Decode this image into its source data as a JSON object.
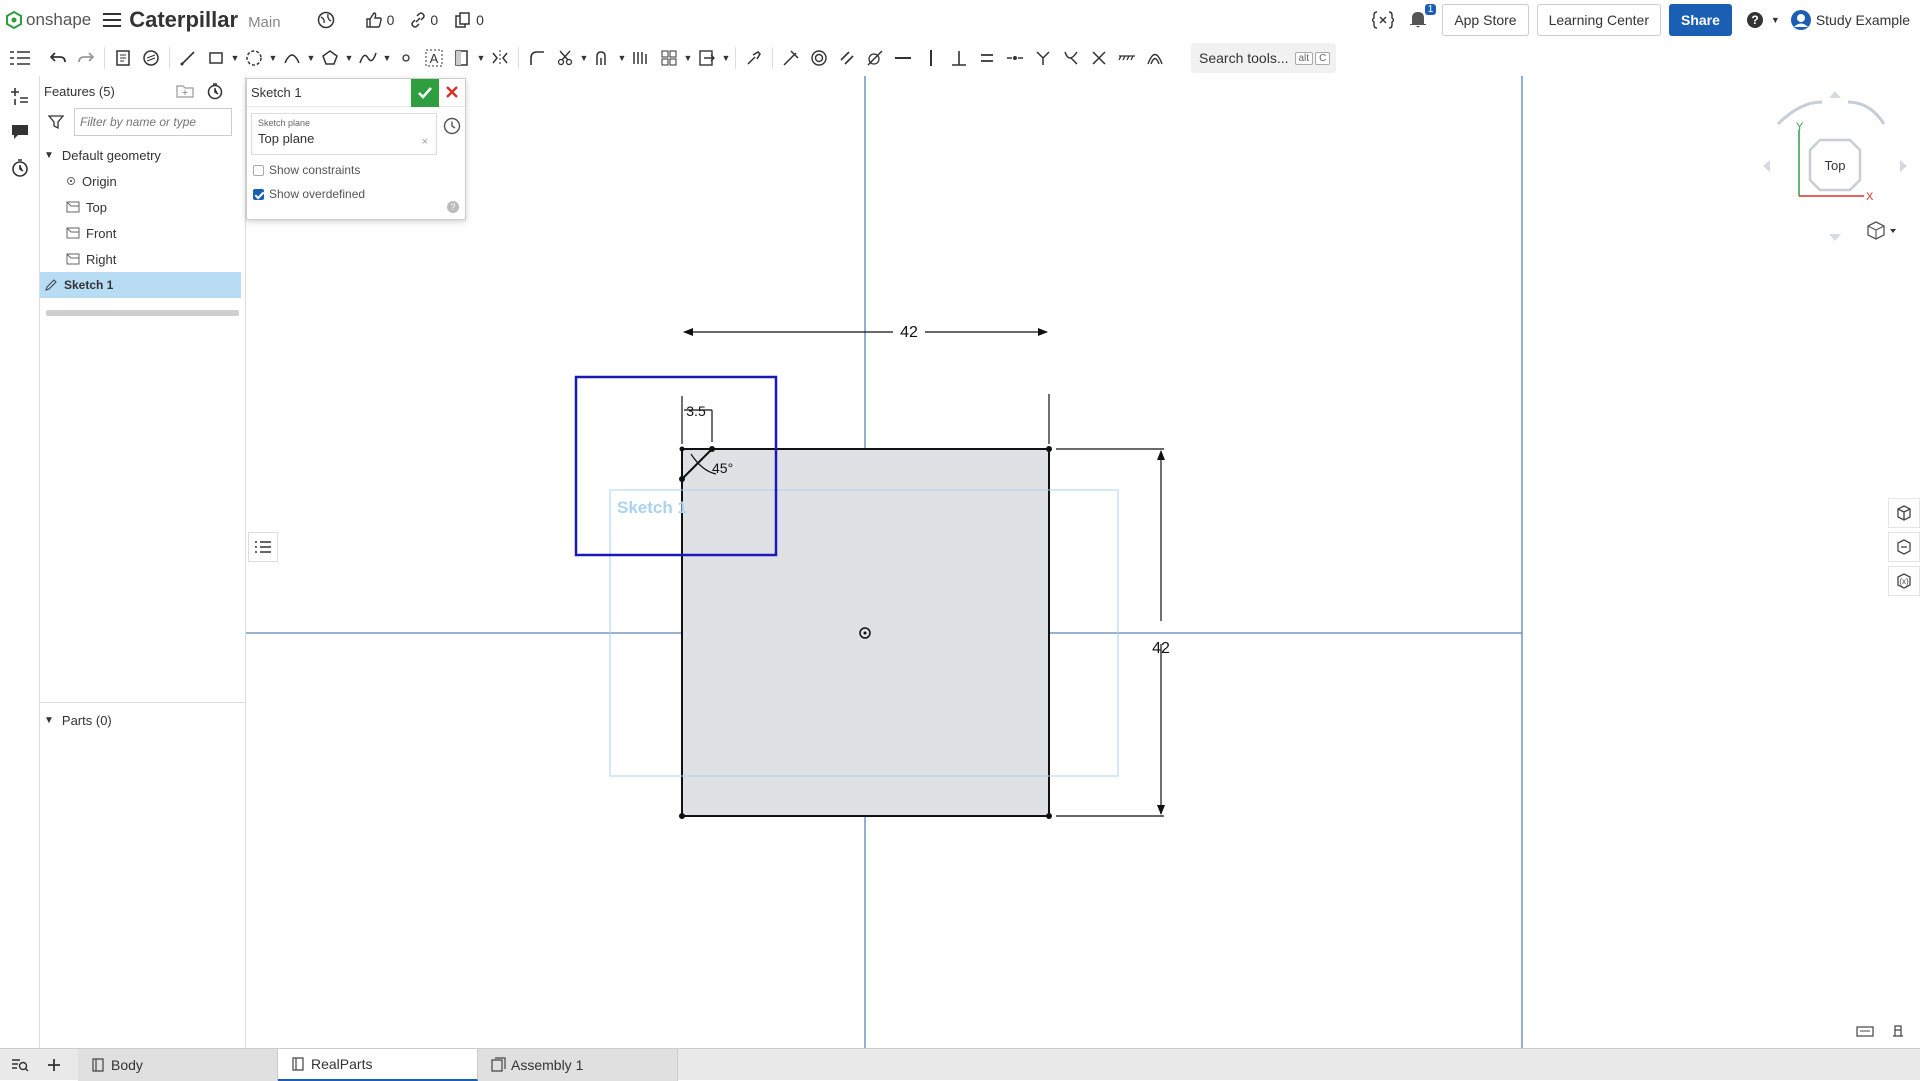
{
  "app": {
    "logo_text": "onshape",
    "document_title": "Caterpillar",
    "branch": "Main",
    "likes": "0",
    "links": "0",
    "copies": "0",
    "notification_count": "1",
    "app_store": "App Store",
    "learning_center": "Learning Center",
    "share": "Share",
    "user_name": "Study Example"
  },
  "toolbar": {
    "search_label": "Search tools...",
    "search_shortcut_1": "alt",
    "search_shortcut_2": "C"
  },
  "features": {
    "header": "Features (5)",
    "filter_placeholder": "Filter by name or type",
    "default_geometry": "Default geometry",
    "items": [
      "Origin",
      "Top",
      "Front",
      "Right"
    ],
    "sketch": "Sketch 1",
    "parts": "Parts (0)"
  },
  "sketch_dialog": {
    "title": "Sketch 1",
    "plane_label": "Sketch plane",
    "plane_value": "Top plane",
    "clear_symbol": "×",
    "show_constraints": "Show constraints",
    "show_overdefined": "Show overdefined",
    "show_constraints_checked": false,
    "show_overdefined_checked": true,
    "help": "?"
  },
  "canvas": {
    "dim_width": "42",
    "dim_height": "42",
    "dim_chamfer": "3.5",
    "dim_angle": "45°",
    "sketch_label": "Sketch 1"
  },
  "viewcube": {
    "face": "Top",
    "axis_y": "Y",
    "axis_x": "X"
  },
  "tabs": [
    "Body",
    "RealParts",
    "Assembly 1"
  ],
  "colors": {
    "accent": "#1a5fb4",
    "ok": "#2e9e3f",
    "cancel": "#d93025",
    "selection_box": "#1a1ab8",
    "sketch_label": "#a9d3ef",
    "axis": "#5b86b5",
    "region": "#dfe1e5"
  }
}
